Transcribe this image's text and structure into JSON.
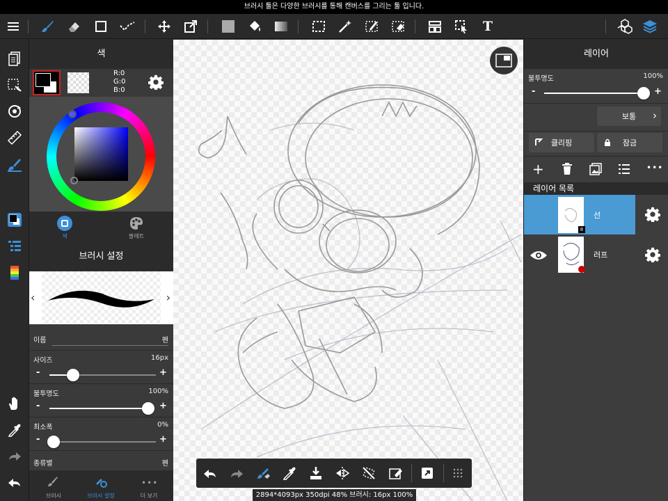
{
  "tooltip": "브러시 툴은 다양한 브러시를 통해 캔버스를 그리는 툴 입니다.",
  "toolbar": {
    "tools": [
      "brush-icon",
      "eraser-icon",
      "shape-icon",
      "dot-icon",
      "move-icon",
      "transform-icon",
      "fill-color-icon",
      "bucket-icon",
      "gradient-icon",
      "select-icon",
      "magic-wand-icon",
      "select-pen-icon",
      "select-eraser-icon",
      "panel-layout-icon",
      "operation-icon",
      "text-icon"
    ],
    "text_tool_label": "T",
    "right": [
      "material-icon",
      "layers-icon"
    ]
  },
  "left_strip": {
    "tools": [
      "page-icon",
      "selection-icon",
      "rotate-icon",
      "ruler-icon",
      "brush-tool-icon",
      "color-swatch-icon",
      "brush-list-icon",
      "palette-icon",
      "hand-icon",
      "eyedropper-icon",
      "redo-icon",
      "undo-icon"
    ]
  },
  "color_panel": {
    "title": "색",
    "rgb": {
      "r": "R:0",
      "g": "G:0",
      "b": "B:0"
    },
    "tabs": [
      "색",
      "팔레트"
    ]
  },
  "brush_panel": {
    "title": "브러시 설정",
    "name_label": "이름",
    "name_value": "펜",
    "size_label": "사이즈",
    "size_value": "16px",
    "size_level": 0.22,
    "opacity_label": "불투명도",
    "opacity_value": "100%",
    "opacity_level": 1.0,
    "min_width_label": "최소폭",
    "min_width_value": "0%",
    "min_width_level": 0.0,
    "type_label": "종류별",
    "type_value": "펜",
    "bottom_tabs": [
      "브러시",
      "브러시 설정",
      "더 보기"
    ]
  },
  "floatbar": {
    "icons": [
      "undo-icon",
      "redo-icon",
      "brush-eraser-toggle-icon",
      "eyedropper-icon",
      "save-icon",
      "flip-icon",
      "rotate-reset-icon",
      "clear-icon",
      "fullscreen-icon",
      "more-dots-icon"
    ]
  },
  "status": "2894*4093px 350dpi 48% 브러시: 16px 100%",
  "layer_panel": {
    "title": "레이어",
    "opacity_label": "불투명도",
    "opacity_value": "100%",
    "opacity_level": 1.0,
    "blend_mode": "보통",
    "clipping_label": "클리핑",
    "lock_label": "잠금",
    "list_title": "레이어 목록",
    "layers": [
      {
        "name": "선",
        "badge": "8",
        "selected": true
      },
      {
        "name": "러프",
        "selected": false
      }
    ]
  },
  "colors": {
    "accent": "#4a9ad4",
    "panel": "#3a3a3a",
    "toolbar": "#2a2a2a",
    "brush_icon": "#3d8fd8"
  }
}
